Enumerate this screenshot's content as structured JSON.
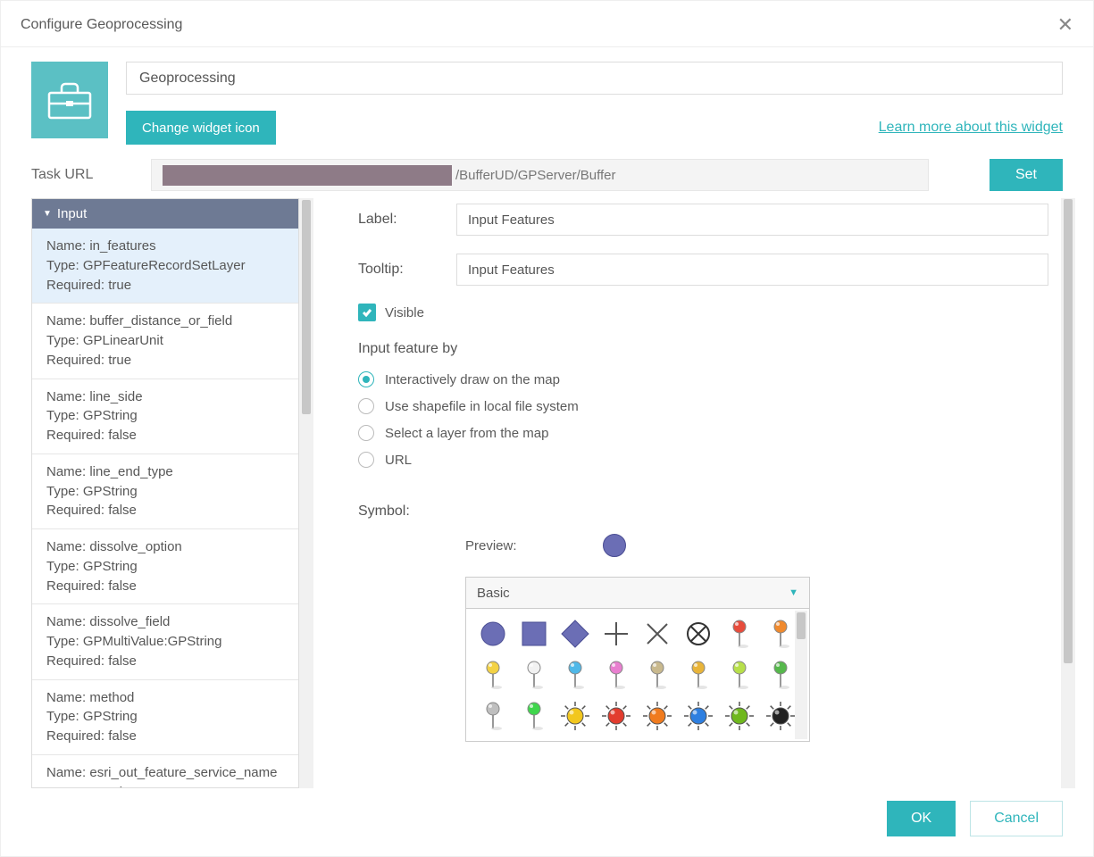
{
  "title": "Configure Geoprocessing",
  "widget_name": "Geoprocessing",
  "change_icon_label": "Change widget icon",
  "learn_more": "Learn more about this widget",
  "task_url_label": "Task URL",
  "task_url_visible": "/BufferUD/GPServer/Buffer",
  "set_label": "Set",
  "input_group": "Input",
  "params": [
    {
      "name": "in_features",
      "type": "GPFeatureRecordSetLayer",
      "required": "true"
    },
    {
      "name": "buffer_distance_or_field",
      "type": "GPLinearUnit",
      "required": "true"
    },
    {
      "name": "line_side",
      "type": "GPString",
      "required": "false"
    },
    {
      "name": "line_end_type",
      "type": "GPString",
      "required": "false"
    },
    {
      "name": "dissolve_option",
      "type": "GPString",
      "required": "false"
    },
    {
      "name": "dissolve_field",
      "type": "GPMultiValue:GPString",
      "required": "false"
    },
    {
      "name": "method",
      "type": "GPString",
      "required": "false"
    },
    {
      "name": "esri_out_feature_service_name",
      "type": "GPString",
      "required": "false"
    }
  ],
  "name_prefix": "Name: ",
  "type_prefix": "Type: ",
  "required_prefix": "Required: ",
  "form": {
    "label_label": "Label:",
    "label_value": "Input Features",
    "tooltip_label": "Tooltip:",
    "tooltip_value": "Input Features",
    "visible_label": "Visible",
    "input_by_label": "Input feature by",
    "radios": [
      "Interactively draw on the map",
      "Use shapefile in local file system",
      "Select a layer from the map",
      "URL"
    ],
    "symbol_label": "Symbol:",
    "preview_label": "Preview:",
    "palette_select": "Basic"
  },
  "footer": {
    "ok": "OK",
    "cancel": "Cancel"
  },
  "palette_icons": [
    "shape-circle",
    "shape-square",
    "shape-diamond",
    "shape-plus",
    "shape-x",
    "shape-circlex",
    "pin-red",
    "pin-orange",
    "pin-yellow",
    "pin-white",
    "pin-cyan",
    "pin-pink",
    "pin-tan",
    "pin-gold",
    "pin-lime",
    "pin-green",
    "pin-gray",
    "pin-brightgreen",
    "sun-yellow",
    "sun-red",
    "sun-orange",
    "sun-blue",
    "sun-green",
    "sun-black"
  ]
}
